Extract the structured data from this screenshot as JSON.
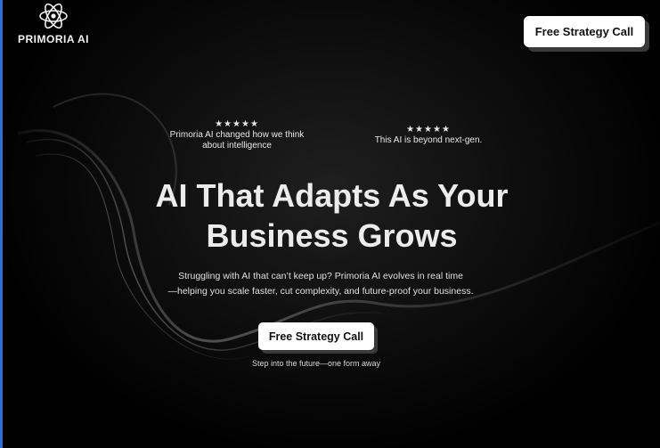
{
  "brand": {
    "name": "PRIMORIA AI",
    "logo_icon": "atom-icon"
  },
  "header": {
    "cta_label": "Free Strategy Call"
  },
  "testimonials": [
    {
      "stars": "★★★★★",
      "quote": "Primoria AI changed how we think about intelligence"
    },
    {
      "stars": "★★★★★",
      "quote": "This AI is beyond next-gen."
    }
  ],
  "hero": {
    "headline_line1": "AI That Adapts As Your",
    "headline_line2": "Business Grows",
    "subtext_line1": "Struggling with AI that can’t keep up? Primoria AI evolves in real time",
    "subtext_line2": "—helping you scale faster, cut complexity, and future-proof your business.",
    "cta_label": "Free Strategy Call",
    "cta_note": "Step into the future—one form away"
  },
  "colors": {
    "background": "#000000",
    "button_bg": "#ffffff",
    "button_text": "#111111",
    "button_shadow": "#3a3a3a",
    "left_edge": "#2d6fd6"
  }
}
